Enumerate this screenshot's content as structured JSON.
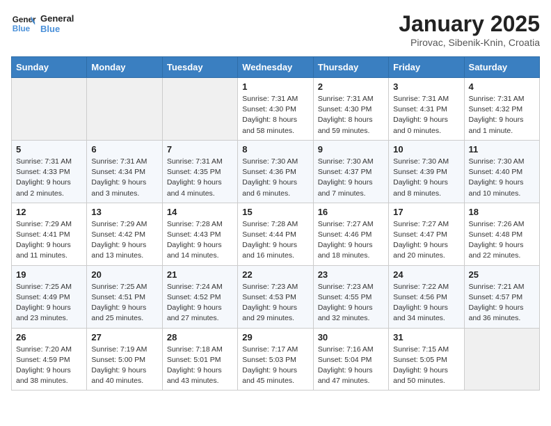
{
  "logo": {
    "line1": "General",
    "line2": "Blue"
  },
  "title": "January 2025",
  "subtitle": "Pirovac, Sibenik-Knin, Croatia",
  "days_header": [
    "Sunday",
    "Monday",
    "Tuesday",
    "Wednesday",
    "Thursday",
    "Friday",
    "Saturday"
  ],
  "weeks": [
    [
      {
        "day": "",
        "info": ""
      },
      {
        "day": "",
        "info": ""
      },
      {
        "day": "",
        "info": ""
      },
      {
        "day": "1",
        "info": "Sunrise: 7:31 AM\nSunset: 4:30 PM\nDaylight: 8 hours\nand 58 minutes."
      },
      {
        "day": "2",
        "info": "Sunrise: 7:31 AM\nSunset: 4:30 PM\nDaylight: 8 hours\nand 59 minutes."
      },
      {
        "day": "3",
        "info": "Sunrise: 7:31 AM\nSunset: 4:31 PM\nDaylight: 9 hours\nand 0 minutes."
      },
      {
        "day": "4",
        "info": "Sunrise: 7:31 AM\nSunset: 4:32 PM\nDaylight: 9 hours\nand 1 minute."
      }
    ],
    [
      {
        "day": "5",
        "info": "Sunrise: 7:31 AM\nSunset: 4:33 PM\nDaylight: 9 hours\nand 2 minutes."
      },
      {
        "day": "6",
        "info": "Sunrise: 7:31 AM\nSunset: 4:34 PM\nDaylight: 9 hours\nand 3 minutes."
      },
      {
        "day": "7",
        "info": "Sunrise: 7:31 AM\nSunset: 4:35 PM\nDaylight: 9 hours\nand 4 minutes."
      },
      {
        "day": "8",
        "info": "Sunrise: 7:30 AM\nSunset: 4:36 PM\nDaylight: 9 hours\nand 6 minutes."
      },
      {
        "day": "9",
        "info": "Sunrise: 7:30 AM\nSunset: 4:37 PM\nDaylight: 9 hours\nand 7 minutes."
      },
      {
        "day": "10",
        "info": "Sunrise: 7:30 AM\nSunset: 4:39 PM\nDaylight: 9 hours\nand 8 minutes."
      },
      {
        "day": "11",
        "info": "Sunrise: 7:30 AM\nSunset: 4:40 PM\nDaylight: 9 hours\nand 10 minutes."
      }
    ],
    [
      {
        "day": "12",
        "info": "Sunrise: 7:29 AM\nSunset: 4:41 PM\nDaylight: 9 hours\nand 11 minutes."
      },
      {
        "day": "13",
        "info": "Sunrise: 7:29 AM\nSunset: 4:42 PM\nDaylight: 9 hours\nand 13 minutes."
      },
      {
        "day": "14",
        "info": "Sunrise: 7:28 AM\nSunset: 4:43 PM\nDaylight: 9 hours\nand 14 minutes."
      },
      {
        "day": "15",
        "info": "Sunrise: 7:28 AM\nSunset: 4:44 PM\nDaylight: 9 hours\nand 16 minutes."
      },
      {
        "day": "16",
        "info": "Sunrise: 7:27 AM\nSunset: 4:46 PM\nDaylight: 9 hours\nand 18 minutes."
      },
      {
        "day": "17",
        "info": "Sunrise: 7:27 AM\nSunset: 4:47 PM\nDaylight: 9 hours\nand 20 minutes."
      },
      {
        "day": "18",
        "info": "Sunrise: 7:26 AM\nSunset: 4:48 PM\nDaylight: 9 hours\nand 22 minutes."
      }
    ],
    [
      {
        "day": "19",
        "info": "Sunrise: 7:25 AM\nSunset: 4:49 PM\nDaylight: 9 hours\nand 23 minutes."
      },
      {
        "day": "20",
        "info": "Sunrise: 7:25 AM\nSunset: 4:51 PM\nDaylight: 9 hours\nand 25 minutes."
      },
      {
        "day": "21",
        "info": "Sunrise: 7:24 AM\nSunset: 4:52 PM\nDaylight: 9 hours\nand 27 minutes."
      },
      {
        "day": "22",
        "info": "Sunrise: 7:23 AM\nSunset: 4:53 PM\nDaylight: 9 hours\nand 29 minutes."
      },
      {
        "day": "23",
        "info": "Sunrise: 7:23 AM\nSunset: 4:55 PM\nDaylight: 9 hours\nand 32 minutes."
      },
      {
        "day": "24",
        "info": "Sunrise: 7:22 AM\nSunset: 4:56 PM\nDaylight: 9 hours\nand 34 minutes."
      },
      {
        "day": "25",
        "info": "Sunrise: 7:21 AM\nSunset: 4:57 PM\nDaylight: 9 hours\nand 36 minutes."
      }
    ],
    [
      {
        "day": "26",
        "info": "Sunrise: 7:20 AM\nSunset: 4:59 PM\nDaylight: 9 hours\nand 38 minutes."
      },
      {
        "day": "27",
        "info": "Sunrise: 7:19 AM\nSunset: 5:00 PM\nDaylight: 9 hours\nand 40 minutes."
      },
      {
        "day": "28",
        "info": "Sunrise: 7:18 AM\nSunset: 5:01 PM\nDaylight: 9 hours\nand 43 minutes."
      },
      {
        "day": "29",
        "info": "Sunrise: 7:17 AM\nSunset: 5:03 PM\nDaylight: 9 hours\nand 45 minutes."
      },
      {
        "day": "30",
        "info": "Sunrise: 7:16 AM\nSunset: 5:04 PM\nDaylight: 9 hours\nand 47 minutes."
      },
      {
        "day": "31",
        "info": "Sunrise: 7:15 AM\nSunset: 5:05 PM\nDaylight: 9 hours\nand 50 minutes."
      },
      {
        "day": "",
        "info": ""
      }
    ]
  ]
}
